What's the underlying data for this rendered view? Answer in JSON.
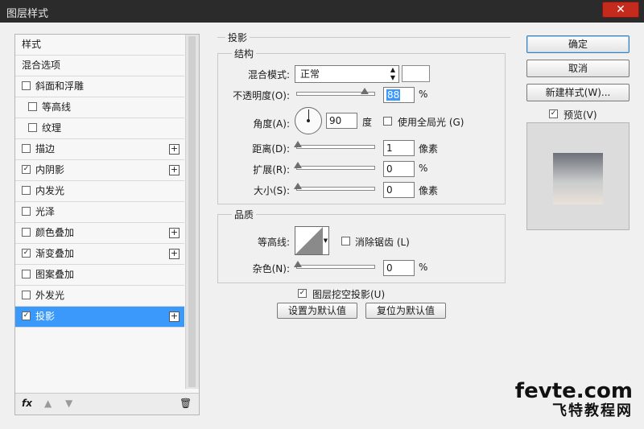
{
  "window": {
    "title": "图层样式",
    "close_label": "✕"
  },
  "style_list": [
    {
      "label": "样式",
      "checkbox": false,
      "checked": false,
      "plus": false,
      "indent": false,
      "selected": false
    },
    {
      "label": "混合选项",
      "checkbox": false,
      "checked": false,
      "plus": false,
      "indent": false,
      "selected": false
    },
    {
      "label": "斜面和浮雕",
      "checkbox": true,
      "checked": false,
      "plus": false,
      "indent": false,
      "selected": false
    },
    {
      "label": "等高线",
      "checkbox": true,
      "checked": false,
      "plus": false,
      "indent": true,
      "selected": false
    },
    {
      "label": "纹理",
      "checkbox": true,
      "checked": false,
      "plus": false,
      "indent": true,
      "selected": false
    },
    {
      "label": "描边",
      "checkbox": true,
      "checked": false,
      "plus": true,
      "indent": false,
      "selected": false
    },
    {
      "label": "内阴影",
      "checkbox": true,
      "checked": true,
      "plus": true,
      "indent": false,
      "selected": false
    },
    {
      "label": "内发光",
      "checkbox": true,
      "checked": false,
      "plus": false,
      "indent": false,
      "selected": false
    },
    {
      "label": "光泽",
      "checkbox": true,
      "checked": false,
      "plus": false,
      "indent": false,
      "selected": false
    },
    {
      "label": "颜色叠加",
      "checkbox": true,
      "checked": false,
      "plus": true,
      "indent": false,
      "selected": false
    },
    {
      "label": "渐变叠加",
      "checkbox": true,
      "checked": true,
      "plus": true,
      "indent": false,
      "selected": false
    },
    {
      "label": "图案叠加",
      "checkbox": true,
      "checked": false,
      "plus": false,
      "indent": false,
      "selected": false
    },
    {
      "label": "外发光",
      "checkbox": true,
      "checked": false,
      "plus": false,
      "indent": false,
      "selected": false
    },
    {
      "label": "投影",
      "checkbox": true,
      "checked": true,
      "plus": true,
      "indent": false,
      "selected": true
    }
  ],
  "left_footer": {
    "fx_label": "fx",
    "up_icon": "arrow-up-icon",
    "down_icon": "arrow-down-icon",
    "trash_icon": "trash-icon"
  },
  "section_title": "投影",
  "structure": {
    "title": "结构",
    "blend_mode_label": "混合模式:",
    "blend_mode_value": "正常",
    "blend_color": "#ffffff",
    "opacity_label": "不透明度(O):",
    "opacity_value": "88",
    "opacity_unit": "%",
    "angle_label": "角度(A):",
    "angle_value": "90",
    "angle_unit": "度",
    "global_light_label": "使用全局光 (G)",
    "global_light_checked": false,
    "distance_label": "距离(D):",
    "distance_value": "1",
    "distance_unit": "像素",
    "spread_label": "扩展(R):",
    "spread_value": "0",
    "spread_unit": "%",
    "size_label": "大小(S):",
    "size_value": "0",
    "size_unit": "像素"
  },
  "quality": {
    "title": "品质",
    "contour_label": "等高线:",
    "anti_alias_label": "消除锯齿 (L)",
    "anti_alias_checked": false,
    "noise_label": "杂色(N):",
    "noise_value": "0",
    "noise_unit": "%"
  },
  "knockout_label": "图层挖空投影(U)",
  "knockout_checked": true,
  "make_default_label": "设置为默认值",
  "reset_default_label": "复位为默认值",
  "buttons": {
    "ok": "确定",
    "cancel": "取消",
    "new_style": "新建样式(W)..."
  },
  "preview_label": "预览(V)",
  "preview_checked": true,
  "watermark": {
    "line1": "fevte.com",
    "line2": "飞特教程网"
  }
}
